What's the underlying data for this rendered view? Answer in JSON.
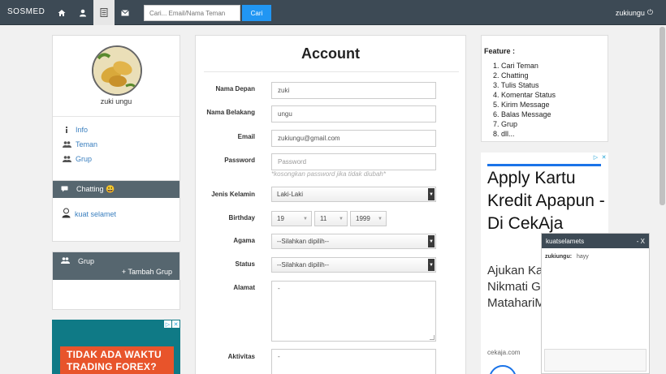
{
  "nav": {
    "brand": "SOSMED",
    "search_placeholder": "Cari... Email/Nama Teman",
    "search_button": "Cari",
    "user": "zukiungu",
    "power_glyph": "⏻"
  },
  "profile": {
    "name": "zuki ungu",
    "links": [
      {
        "label": "Info",
        "icon": "info-icon"
      },
      {
        "label": "Teman",
        "icon": "users-icon"
      },
      {
        "label": "Grup",
        "icon": "group-icon"
      }
    ]
  },
  "chat_panel": {
    "title": "Chatting",
    "emoji": "😃",
    "friend": "kuat selamet"
  },
  "group_panel": {
    "title": "Grup",
    "add_label": "+ Tambah Grup"
  },
  "ad_left": {
    "line1": "TIDAK ADA WAKTU",
    "line2": "TRADING FOREX?"
  },
  "account": {
    "title": "Account",
    "first_name_label": "Nama Depan",
    "first_name_value": "zuki",
    "last_name_label": "Nama Belakang",
    "last_name_value": "ungu",
    "email_label": "Email",
    "email_value": "zukiungu@gmail.com",
    "password_label": "Password",
    "password_placeholder": "Password",
    "password_help": "*kosongkan password jika tidak diubah*",
    "gender_label": "Jenis Kelamin",
    "gender_value": "Laki-Laki",
    "birthday_label": "Birthday",
    "birthday_day": "19",
    "birthday_month": "11",
    "birthday_year": "1999",
    "religion_label": "Agama",
    "religion_value": "--Silahkan dipilih--",
    "status_label": "Status",
    "status_value": "--Silahkan dipilih--",
    "address_label": "Alamat",
    "address_value": "-",
    "activity_label": "Aktivitas",
    "activity_value": "-"
  },
  "feature": {
    "title": "Feature :",
    "items": [
      "1. Cari Teman",
      "2. Chatting",
      "3. Tulis Status",
      "4. Komentar Status",
      "5. Kirim Message",
      "6. Balas Message",
      "7. Grup",
      "8. dll..."
    ]
  },
  "ad_right": {
    "headline": "Apply Kartu Kredit Apapun - Di CekAja",
    "body": "Ajukan Ka Di CekAja. Nikmati Gr Voucher 5 MatahariM",
    "domain": "cekaja.com"
  },
  "chat_popup": {
    "title": "kuatselamets",
    "close": "- X",
    "sender": "zukiungu:",
    "message": "hayy"
  },
  "colors": {
    "navbar": "#3d4a55",
    "accent": "#2196f3",
    "panel_head": "#56666f",
    "link": "#3a7fbf"
  }
}
